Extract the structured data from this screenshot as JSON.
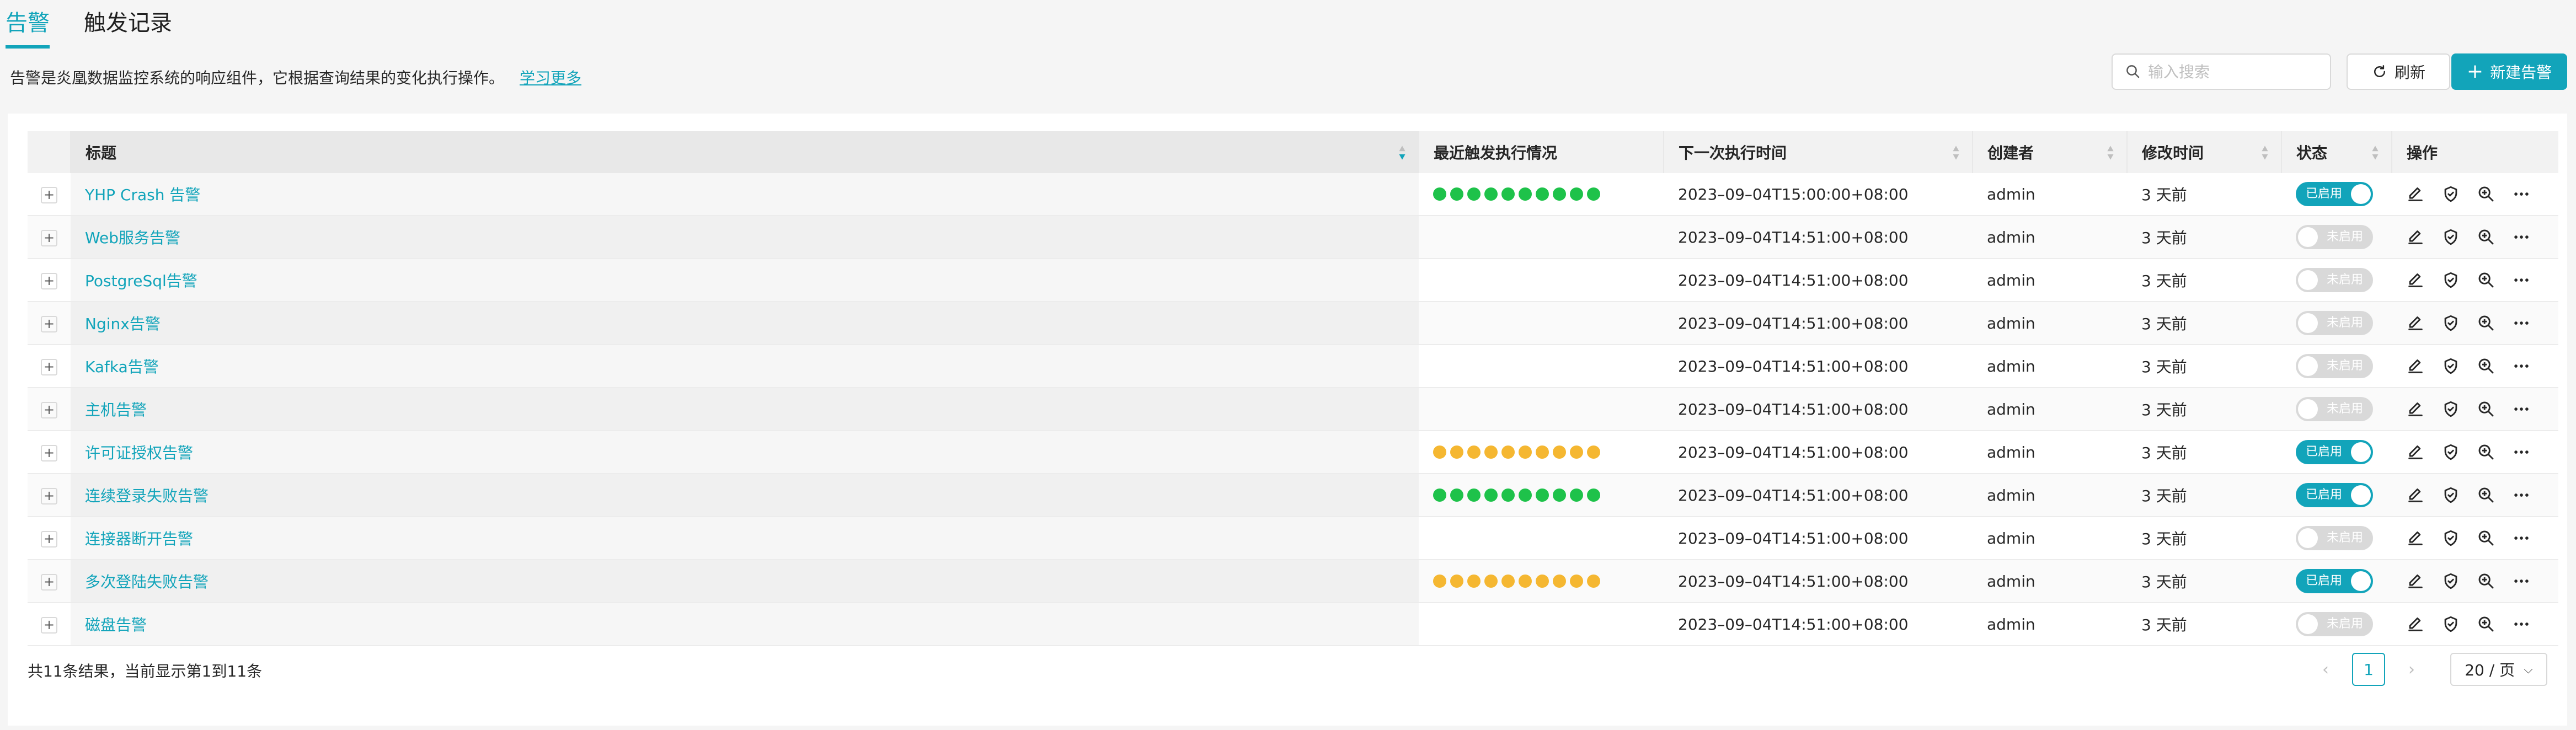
{
  "tabs": {
    "active": "告警",
    "second": "触发记录"
  },
  "description": {
    "text": "告警是炎凰数据监控系统的响应组件，它根据查询结果的变化执行操作。",
    "link": "学习更多"
  },
  "search": {
    "placeholder": "输入搜索"
  },
  "buttons": {
    "refresh": "刷新",
    "new_alert": "新建告警"
  },
  "columns": [
    "标题",
    "最近触发执行情况",
    "下一次执行时间",
    "创建者",
    "修改时间",
    "状态",
    "操作"
  ],
  "colors": {
    "accent": "#12a4ba",
    "success": "#1ec24a",
    "warning": "#f5b731"
  },
  "rows": [
    {
      "title": "YHP Crash 告警",
      "dots": "green",
      "next": "2023–09–04T15:00:00+08:00",
      "creator": "admin",
      "modified": "3 天前",
      "enabled": true,
      "status": "已启用"
    },
    {
      "title": "Web服务告警",
      "dots": "none",
      "next": "2023–09–04T14:51:00+08:00",
      "creator": "admin",
      "modified": "3 天前",
      "enabled": false,
      "status": "未启用"
    },
    {
      "title": "PostgreSql告警",
      "dots": "none",
      "next": "2023–09–04T14:51:00+08:00",
      "creator": "admin",
      "modified": "3 天前",
      "enabled": false,
      "status": "未启用"
    },
    {
      "title": "Nginx告警",
      "dots": "none",
      "next": "2023–09–04T14:51:00+08:00",
      "creator": "admin",
      "modified": "3 天前",
      "enabled": false,
      "status": "未启用"
    },
    {
      "title": "Kafka告警",
      "dots": "none",
      "next": "2023–09–04T14:51:00+08:00",
      "creator": "admin",
      "modified": "3 天前",
      "enabled": false,
      "status": "未启用"
    },
    {
      "title": "主机告警",
      "dots": "none",
      "next": "2023–09–04T14:51:00+08:00",
      "creator": "admin",
      "modified": "3 天前",
      "enabled": false,
      "status": "未启用"
    },
    {
      "title": "许可证授权告警",
      "dots": "yellow",
      "next": "2023–09–04T14:51:00+08:00",
      "creator": "admin",
      "modified": "3 天前",
      "enabled": true,
      "status": "已启用"
    },
    {
      "title": "连续登录失败告警",
      "dots": "green",
      "next": "2023–09–04T14:51:00+08:00",
      "creator": "admin",
      "modified": "3 天前",
      "enabled": true,
      "status": "已启用"
    },
    {
      "title": "连接器断开告警",
      "dots": "none",
      "next": "2023–09–04T14:51:00+08:00",
      "creator": "admin",
      "modified": "3 天前",
      "enabled": false,
      "status": "未启用"
    },
    {
      "title": "多次登陆失败告警",
      "dots": "yellow",
      "next": "2023–09–04T14:51:00+08:00",
      "creator": "admin",
      "modified": "3 天前",
      "enabled": true,
      "status": "已启用"
    },
    {
      "title": "磁盘告警",
      "dots": "none",
      "next": "2023–09–04T14:51:00+08:00",
      "creator": "admin",
      "modified": "3 天前",
      "enabled": false,
      "status": "未启用"
    }
  ],
  "footer": {
    "summary": "共11条结果，当前显示第1到11条",
    "current_page": "1",
    "page_size": "20 / 页"
  }
}
